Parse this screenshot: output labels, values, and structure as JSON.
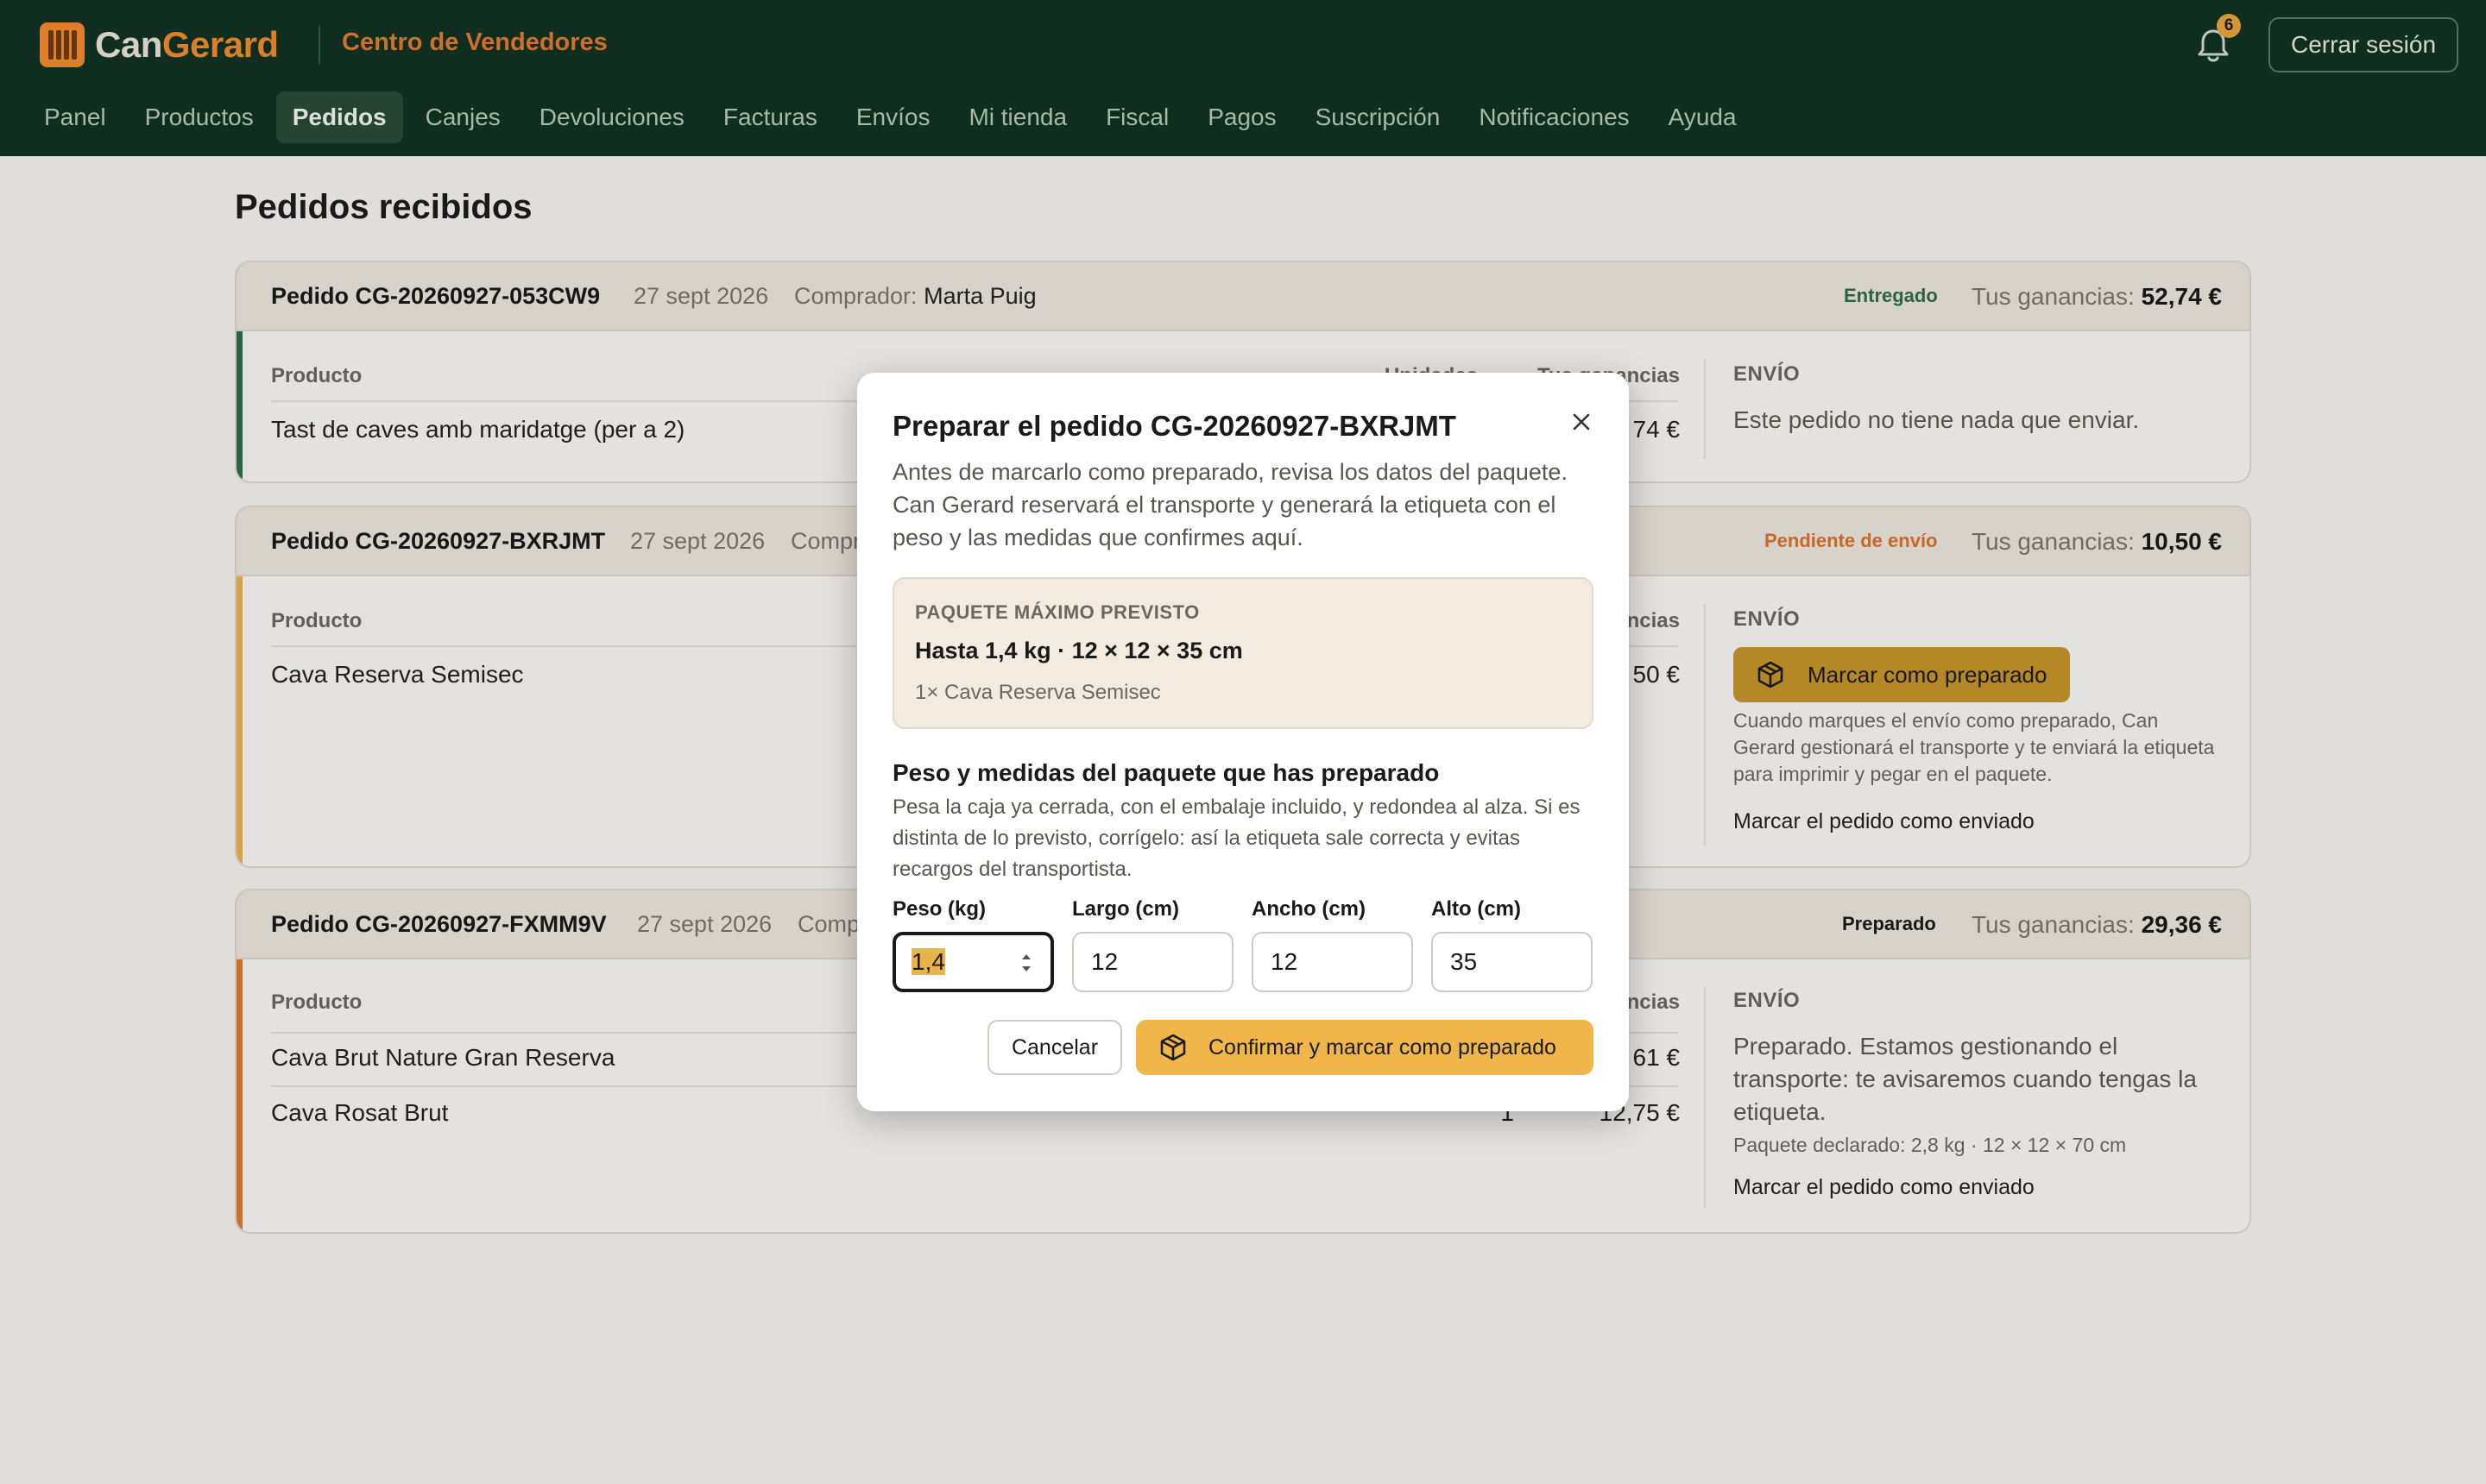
{
  "header": {
    "brand_part1": "Can",
    "brand_part2": "Gerard",
    "section_title": "Centro de Vendedores",
    "notification_count": "6",
    "logout_label": "Cerrar sesión"
  },
  "nav": [
    {
      "label": "Panel"
    },
    {
      "label": "Productos"
    },
    {
      "label": "Pedidos",
      "active": true
    },
    {
      "label": "Canjes"
    },
    {
      "label": "Devoluciones"
    },
    {
      "label": "Facturas"
    },
    {
      "label": "Envíos"
    },
    {
      "label": "Mi tienda"
    },
    {
      "label": "Fiscal"
    },
    {
      "label": "Pagos"
    },
    {
      "label": "Suscripción"
    },
    {
      "label": "Notificaciones"
    },
    {
      "label": "Ayuda"
    }
  ],
  "page_title": "Pedidos recibidos",
  "orders": [
    {
      "order_label": "Pedido CG-20260927-053CW9",
      "date": "27 sept 2026",
      "buyer_label": "Comprador:",
      "buyer_name": "Marta Puig",
      "status": "Entregado",
      "earnings_label": "Tus ganancias:",
      "earnings": "52,74 €",
      "col_product": "Producto",
      "col_units_partial": "Unidades",
      "col_earnings_partial": "Tus ganancias",
      "products": [
        {
          "name": "Tast de caves amb maridatge (per a 2)",
          "amount_partial": "74 €"
        }
      ],
      "shipping_header": "ENVÍO",
      "shipping_text": "Este pedido no tiene nada que enviar."
    },
    {
      "order_label": "Pedido CG-20260927-BXRJMT",
      "date": "27 sept 2026",
      "buyer_label_partial": "Compr",
      "status": "Pendiente de envío",
      "earnings_label": "Tus ganancias:",
      "earnings": "10,50 €",
      "col_product": "Producto",
      "col_earnings_partial": "ncias",
      "products": [
        {
          "name": "Cava Reserva Semisec",
          "amount_partial": "50 €"
        }
      ],
      "shipping_header": "ENVÍO",
      "prepare_button": "Marcar como preparado",
      "shipping_note": "Cuando marques el envío como preparado, Can Gerard gestionará el transporte y te enviará la etiqueta para imprimir y pegar en el paquete.",
      "mark_shipped": "Marcar el pedido como enviado"
    },
    {
      "order_label": "Pedido CG-20260927-FXMM9V",
      "date": "27 sept 2026",
      "buyer_label_partial": "Comp",
      "status": "Preparado",
      "earnings_label": "Tus ganancias:",
      "earnings": "29,36 €",
      "col_product": "Producto",
      "col_earnings_partial": "ncias",
      "products": [
        {
          "name": "Cava Brut Nature Gran Reserva",
          "amount_partial": "61 €"
        },
        {
          "name": "Cava Rosat Brut",
          "units_partial": "1",
          "amount_partial": "12,75 €"
        }
      ],
      "shipping_header": "ENVÍO",
      "shipping_text": "Preparado. Estamos gestionando el transporte: te avisaremos cuando tengas la etiqueta.",
      "declared_package": "Paquete declarado: 2,8 kg · 12 × 12 × 70 cm",
      "mark_shipped": "Marcar el pedido como enviado"
    }
  ],
  "modal": {
    "title": "Preparar el pedido CG-20260927-BXRJMT",
    "description": "Antes de marcarlo como preparado, revisa los datos del paquete. Can Gerard reservará el transporte y generará la etiqueta con el peso y las medidas que confirmes aquí.",
    "box_header": "PAQUETE MÁXIMO PREVISTO",
    "box_main": "Hasta 1,4 kg · 12 × 12 × 35 cm",
    "box_sub": "1× Cava Reserva Semisec",
    "section_header": "Peso y medidas del paquete que has preparado",
    "section_desc": "Pesa la caja ya cerrada, con el embalaje incluido, y redondea al alza. Si es distinta de lo previsto, corrígelo: así la etiqueta sale correcta y evitas recargos del transportista.",
    "fields": [
      {
        "label": "Peso (kg)",
        "value": "1,4"
      },
      {
        "label": "Largo (cm)",
        "value": "12"
      },
      {
        "label": "Ancho (cm)",
        "value": "12"
      },
      {
        "label": "Alto (cm)",
        "value": "35"
      }
    ],
    "cancel_label": "Cancelar",
    "confirm_label": "Confirmar y marcar como preparado"
  },
  "colors": {
    "header_bg": "#113222",
    "accent_orange": "#f08a2c",
    "accent_gold": "#f0b64a",
    "status_delivered": "#2f6b47",
    "status_pending": "#d9702a",
    "status_prepared": "#1a1a1a"
  }
}
